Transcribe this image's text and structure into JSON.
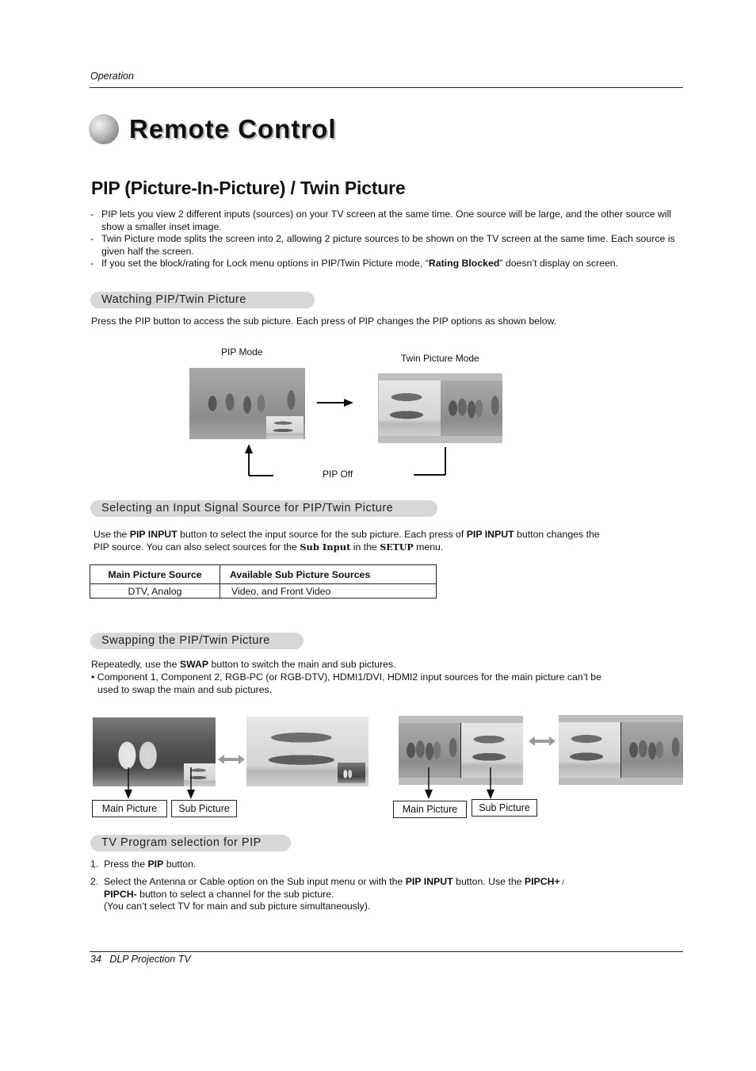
{
  "header": {
    "section_label": "Operation"
  },
  "title": {
    "text": "Remote Control"
  },
  "section": {
    "title": "PIP (Picture-In-Picture) / Twin Picture"
  },
  "intro_bullets": [
    {
      "text": "PIP lets you view 2 different inputs (sources) on your TV screen at the same time. One source will be large, and the other source will show a smaller inset image."
    },
    {
      "text": "Twin Picture mode splits the screen into 2, allowing 2 picture sources to be shown on the TV screen at the same time. Each source is given half the screen."
    },
    {
      "pre": "If you set the block/rating for Lock menu options in PIP/Twin Picture mode, “",
      "bold": "Rating Blocked",
      "post": "” doesn’t display on screen."
    }
  ],
  "watching": {
    "heading": "Watching PIP/Twin Picture",
    "text": "Press the PIP button to access the sub picture. Each press of PIP changes the PIP options as shown below.",
    "diagram": {
      "pip_mode_label": "PIP Mode",
      "twin_mode_label": "Twin Picture Mode",
      "pip_off_label": "PIP Off"
    }
  },
  "selecting": {
    "heading": "Selecting an Input Signal Source for PIP/Twin Picture",
    "text_parts": [
      {
        "t": "Use the ",
        "b": false
      },
      {
        "t": "PIP INPUT",
        "b": true
      },
      {
        "t": " button to select the input source for the sub picture. Each press of ",
        "b": false
      },
      {
        "t": "PIP INPUT",
        "b": true
      },
      {
        "t": " button changes the PIP source. You can also select sources for the ",
        "b": false
      },
      {
        "t": "Sub Input",
        "b": true
      },
      {
        "t": " in the ",
        "b": false
      },
      {
        "t": "SETUP",
        "b": true
      },
      {
        "t": " menu.",
        "b": false
      }
    ],
    "table": {
      "headers": [
        "Main Picture Source",
        "Available Sub Picture Sources"
      ],
      "rows": [
        [
          "DTV, Analog",
          "Video, and Front Video"
        ]
      ]
    }
  },
  "swapping": {
    "heading": "Swapping the PIP/Twin Picture",
    "line1_pre": "Repeatedly, use the ",
    "line1_bold": "SWAP",
    "line1_post": " button to switch the main and sub pictures.",
    "note": "• Component 1, Component 2, RGB-PC (or RGB-DTV), HDMI1/DVI, HDMI2 input sources for the main picture can’t be used to swap the main and sub pictures.",
    "main_picture_label": "Main Picture",
    "sub_picture_label": "Sub Picture"
  },
  "tv_program": {
    "heading": "TV Program selection for PIP",
    "step1": {
      "num": "1.",
      "pre": "Press the ",
      "bold": "PIP",
      "post": " button."
    },
    "step2": {
      "num": "2.",
      "parts": [
        {
          "t": "Select the Antenna or Cable option on the Sub input menu or with the ",
          "b": false
        },
        {
          "t": "PIP INPUT",
          "b": true
        },
        {
          "t": " button. Use the ",
          "b": false
        },
        {
          "t": "PIPCH+",
          "b": true
        },
        {
          "t": " / ",
          "b": false
        },
        {
          "t": "PIPCH-",
          "b": true
        },
        {
          "t": " button to select a channel for the sub picture.",
          "b": false
        }
      ],
      "note": "(You can’t select TV for main and sub picture simultaneously)."
    }
  },
  "footer": {
    "page_number": "34",
    "doc_title": "DLP Projection TV"
  }
}
